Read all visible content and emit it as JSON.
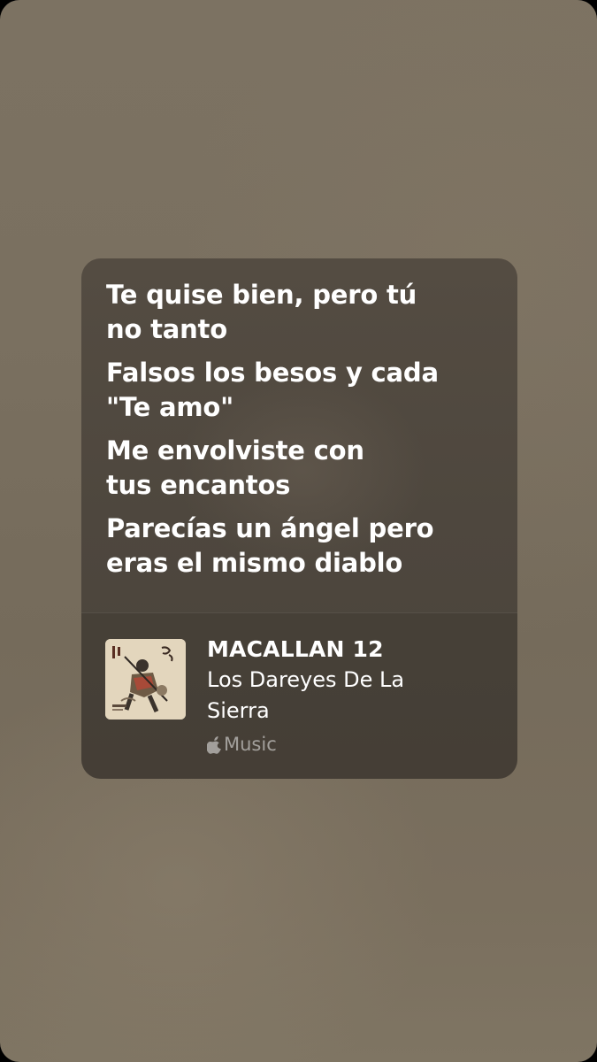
{
  "lyrics": {
    "lines": [
      "Te quise bien, pero tú\nno tanto",
      "Falsos los besos y cada\n\"Te amo\"",
      "Me envolviste con\ntus encantos",
      "Parecías un ángel pero\neras el mismo diablo"
    ]
  },
  "track": {
    "title": "MACALLAN 12",
    "artist": "Los Dareyes De La\nSierra",
    "cover_icon": "album-cover-samurai-artwork",
    "provider_icon": "apple-logo-icon",
    "provider_label": "Music"
  }
}
